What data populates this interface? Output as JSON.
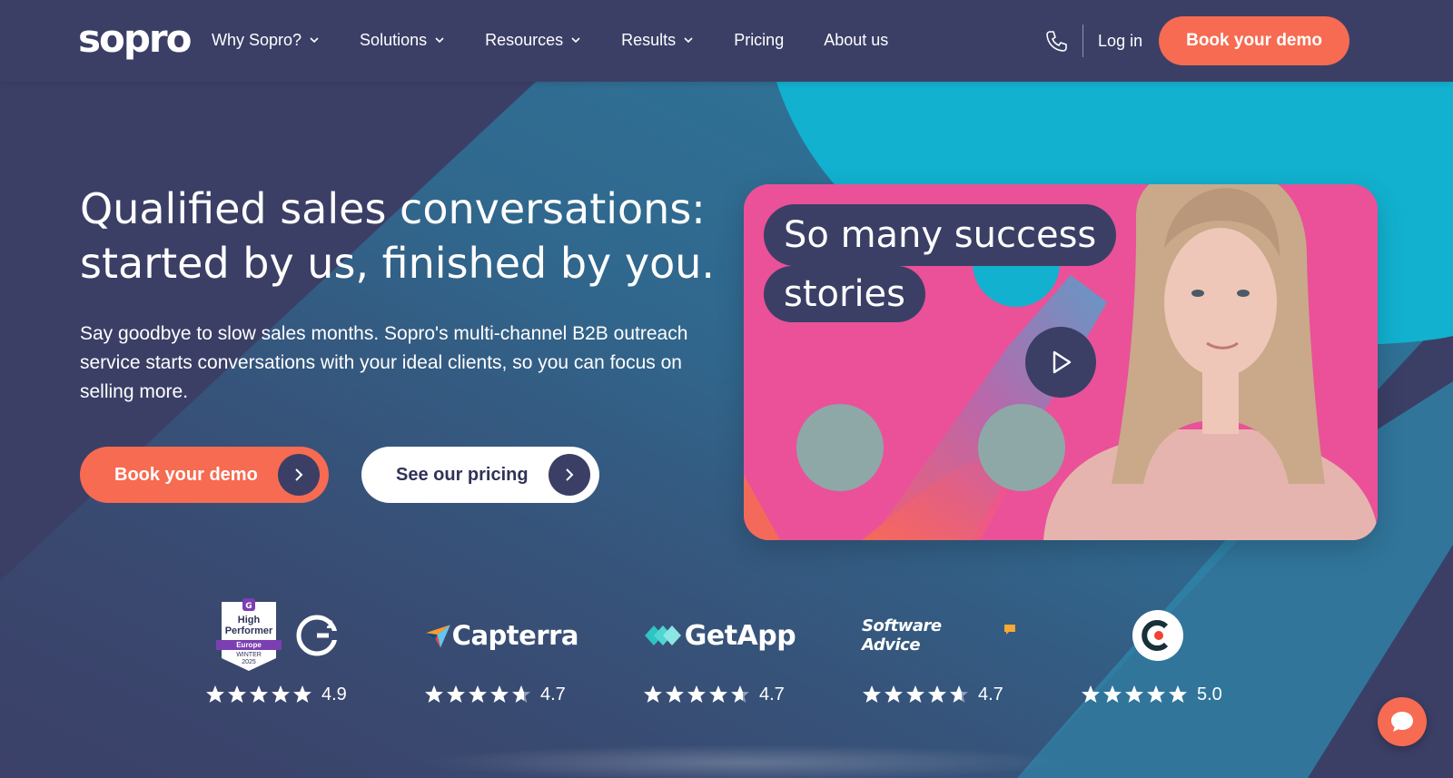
{
  "brand": {
    "logo_text": "sopro"
  },
  "nav": {
    "items": [
      {
        "label": "Why Sopro?",
        "has_dropdown": true
      },
      {
        "label": "Solutions",
        "has_dropdown": true
      },
      {
        "label": "Resources",
        "has_dropdown": true
      },
      {
        "label": "Results",
        "has_dropdown": true
      },
      {
        "label": "Pricing",
        "has_dropdown": false
      },
      {
        "label": "About us",
        "has_dropdown": false
      }
    ],
    "login_label": "Log in",
    "cta_label": "Book your demo",
    "phone_icon": "phone-icon"
  },
  "hero": {
    "title_line1": "Qualified sales conversations:",
    "title_line2": "started by us, finished by you.",
    "subtitle": "Say goodbye to slow sales months. Sopro's multi-channel B2B outreach service starts conversations with your ideal clients, so you can focus on selling more.",
    "primary_cta": "Book your demo",
    "secondary_cta": "See our pricing"
  },
  "video": {
    "caption_line1": "So many success",
    "caption_line2": "stories",
    "play_icon": "play-icon"
  },
  "ratings": [
    {
      "platform_icon": "g2-icon",
      "badge_line1": "High",
      "badge_line2": "Performer",
      "badge_region": "Europe",
      "badge_season_line1": "WINTER",
      "badge_season_line2": "2025",
      "score": "4.9",
      "stars": 5
    },
    {
      "platform": "Capterra",
      "score": "4.7",
      "stars": 4.7
    },
    {
      "platform": "GetApp",
      "score": "4.7",
      "stars": 4.7
    },
    {
      "platform": "Software Advice",
      "score": "4.7",
      "stars": 4.7
    },
    {
      "platform_icon": "clutch-icon",
      "score": "5.0",
      "stars": 5
    }
  ],
  "colors": {
    "navy": "#3b3f66",
    "coral": "#f66b52",
    "teal": "#12b1cf",
    "pink": "#ea5198"
  },
  "chat": {
    "icon": "chat-icon"
  }
}
